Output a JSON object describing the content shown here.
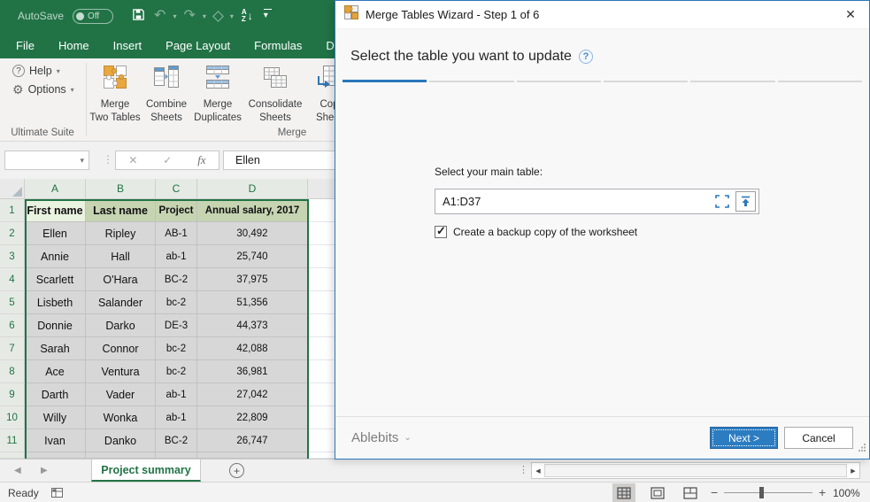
{
  "excel": {
    "titlebar": {
      "autosave_label": "AutoSave",
      "autosave_state": "Off"
    },
    "menu_tabs": [
      "File",
      "Home",
      "Insert",
      "Page Layout",
      "Formulas",
      "Data"
    ],
    "ribbon": {
      "help": "Help",
      "options": "Options",
      "group_ultimate": "Ultimate Suite",
      "group_merge": "Merge",
      "buttons": [
        {
          "icon": "merge-two-tables",
          "lines": [
            "Merge",
            "Two Tables"
          ]
        },
        {
          "icon": "combine-sheets",
          "lines": [
            "Combine",
            "Sheets"
          ]
        },
        {
          "icon": "merge-duplicates",
          "lines": [
            "Merge",
            "Duplicates"
          ]
        },
        {
          "icon": "consolidate-sheets",
          "lines": [
            "Consolidate",
            "Sheets"
          ]
        },
        {
          "icon": "copy-sheet",
          "lines": [
            "Cop",
            "Sheet"
          ]
        }
      ]
    },
    "formula_bar": {
      "name_box_value": "",
      "fx_label": "fx",
      "value": "Ellen"
    },
    "sheet": {
      "column_headers": [
        "A",
        "B",
        "C",
        "D"
      ],
      "row_numbers": [
        "1",
        "2",
        "3",
        "4",
        "5",
        "6",
        "7",
        "8",
        "9",
        "10",
        "11"
      ],
      "table_headers": [
        "First name",
        "Last name",
        "Project",
        "Annual salary, 2017"
      ],
      "table_rows": [
        [
          "Ellen",
          "Ripley",
          "AB-1",
          "30,492"
        ],
        [
          "Annie",
          "Hall",
          "ab-1",
          "25,740"
        ],
        [
          "Scarlett",
          "O'Hara",
          "BC-2",
          "37,975"
        ],
        [
          "Lisbeth",
          "Salander",
          "bc-2",
          "51,356"
        ],
        [
          "Donnie",
          "Darko",
          "DE-3",
          "44,373"
        ],
        [
          "Sarah",
          "Connor",
          "bc-2",
          "42,088"
        ],
        [
          "Ace",
          "Ventura",
          "bc-2",
          "36,981"
        ],
        [
          "Darth",
          "Vader",
          "ab-1",
          "27,042"
        ],
        [
          "Willy",
          "Wonka",
          "ab-1",
          "22,809"
        ],
        [
          "Ivan",
          "Danko",
          "BC-2",
          "26,747"
        ]
      ]
    },
    "tab_bar": {
      "sheet_tab": "Project summary"
    },
    "status_bar": {
      "mode": "Ready",
      "zoom_level": "100%"
    }
  },
  "dialog": {
    "title": "Merge Tables Wizard - Step 1 of 6",
    "heading": "Select the table you want to update",
    "steps": {
      "total": 6,
      "active": 1
    },
    "main_table_label": "Select your main table:",
    "range_value": "A1:D37",
    "backup_label": "Create a backup copy of the worksheet",
    "backup_checked": true,
    "brand": "Ablebits",
    "next_label": "Next >",
    "cancel_label": "Cancel"
  },
  "colors": {
    "excel_green": "#217346",
    "accent_blue": "#2b77bd",
    "selection_gray": "#d7d7d7",
    "table_header_green": "#c6d4b2",
    "active_cell_green": "#eaf2e0"
  }
}
